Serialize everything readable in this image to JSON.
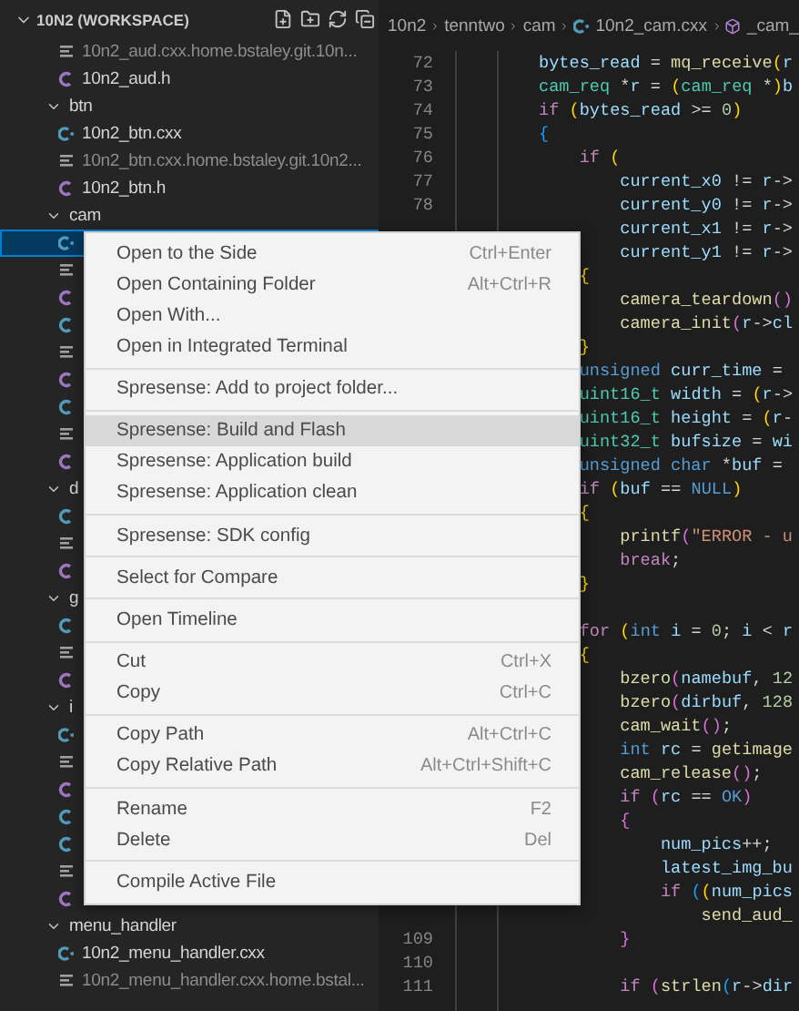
{
  "sidebar": {
    "title": "10N2 (WORKSPACE)",
    "expanded": true,
    "tree": [
      {
        "kind": "text",
        "name": "10n2_aud.cxx.home.bstaley.git.10n...",
        "dimmed": true,
        "selected": false
      },
      {
        "kind": "header",
        "name": "10n2_aud.h",
        "dimmed": false,
        "selected": false
      },
      {
        "kind": "folder",
        "name": "btn",
        "expanded": true,
        "selected": false,
        "children": [
          {
            "kind": "cpp",
            "name": "10n2_btn.cxx",
            "dimmed": false,
            "selected": false
          },
          {
            "kind": "text",
            "name": "10n2_btn.cxx.home.bstaley.git.10n2...",
            "dimmed": true,
            "selected": false
          },
          {
            "kind": "header",
            "name": "10n2_btn.h",
            "dimmed": false,
            "selected": false
          }
        ]
      },
      {
        "kind": "folder",
        "name": "cam",
        "expanded": true,
        "selected": false,
        "children": [
          {
            "kind": "cpp",
            "selected": true
          },
          {
            "kind": "text",
            "selected": false
          },
          {
            "kind": "header",
            "selected": false
          },
          {
            "kind": "c",
            "selected": false
          },
          {
            "kind": "text",
            "selected": false
          },
          {
            "kind": "header",
            "selected": false
          },
          {
            "kind": "c",
            "selected": false
          },
          {
            "kind": "text",
            "selected": false
          },
          {
            "kind": "header",
            "selected": false
          }
        ]
      },
      {
        "kind": "folder",
        "name": "d",
        "expanded": true,
        "selected": false,
        "children": [
          {
            "kind": "c",
            "selected": false
          },
          {
            "kind": "text",
            "selected": false
          },
          {
            "kind": "header",
            "selected": false
          }
        ]
      },
      {
        "kind": "folder",
        "name": "g",
        "expanded": true,
        "selected": false,
        "children": [
          {
            "kind": "c",
            "selected": false
          },
          {
            "kind": "text",
            "selected": false
          },
          {
            "kind": "header",
            "selected": false
          }
        ]
      },
      {
        "kind": "folder",
        "name": "i",
        "expanded": true,
        "selected": false,
        "children": [
          {
            "kind": "cpp",
            "selected": false
          },
          {
            "kind": "text",
            "selected": false
          },
          {
            "kind": "header",
            "selected": false
          },
          {
            "kind": "c",
            "selected": false
          },
          {
            "kind": "c",
            "selected": false
          },
          {
            "kind": "text",
            "selected": false
          },
          {
            "kind": "header",
            "selected": false
          }
        ]
      },
      {
        "kind": "folder",
        "name": "menu_handler",
        "expanded": true,
        "selected": false,
        "children": [
          {
            "kind": "cpp",
            "name": "10n2_menu_handler.cxx",
            "dimmed": false,
            "selected": false
          },
          {
            "kind": "text",
            "name": "10n2_menu_handler.cxx.home.bstal...",
            "dimmed": true,
            "selected": false
          }
        ]
      }
    ]
  },
  "breadcrumb": [
    {
      "kind": "folder",
      "label": "10n2"
    },
    {
      "kind": "folder",
      "label": "tenntwo"
    },
    {
      "kind": "folder",
      "label": "cam"
    },
    {
      "kind": "cpp",
      "label": "10n2_cam.cxx"
    },
    {
      "kind": "symbol",
      "label": "_cam_"
    }
  ],
  "editor": {
    "lines": [
      {
        "n": "72",
        "tokens": [
          {
            "kind": "var",
            "text": "bytes_read"
          },
          {
            "kind": "op",
            "text": " = "
          },
          {
            "kind": "fn",
            "text": "mq_receive"
          },
          {
            "kind": "b1",
            "text": "("
          },
          {
            "kind": "var",
            "text": "r"
          }
        ]
      },
      {
        "n": "73",
        "tokens": [
          {
            "kind": "type",
            "text": "cam_req"
          },
          {
            "kind": "op",
            "text": " *"
          },
          {
            "kind": "var",
            "text": "r"
          },
          {
            "kind": "op",
            "text": " = "
          },
          {
            "kind": "b1",
            "text": "("
          },
          {
            "kind": "type",
            "text": "cam_req"
          },
          {
            "kind": "op",
            "text": " *"
          },
          {
            "kind": "b1",
            "text": ")"
          },
          {
            "kind": "var",
            "text": "b"
          }
        ]
      },
      {
        "n": "74",
        "tokens": [
          {
            "kind": "kw",
            "text": "if "
          },
          {
            "kind": "b1",
            "text": "("
          },
          {
            "kind": "var",
            "text": "bytes_read"
          },
          {
            "kind": "op",
            "text": " >= "
          },
          {
            "kind": "num",
            "text": "0"
          },
          {
            "kind": "b1",
            "text": ")"
          }
        ]
      },
      {
        "n": "75",
        "tokens": [
          {
            "kind": "b3",
            "text": "{"
          }
        ]
      },
      {
        "n": "76",
        "tokens": [
          {
            "kind": "kw",
            "text": "    if "
          },
          {
            "kind": "b1",
            "text": "("
          }
        ]
      },
      {
        "n": "77",
        "tokens": [
          {
            "kind": "var",
            "text": "        current_x0"
          },
          {
            "kind": "op",
            "text": " != "
          },
          {
            "kind": "var",
            "text": "r"
          },
          {
            "kind": "op",
            "text": "->"
          }
        ]
      },
      {
        "n": "78",
        "tokens": [
          {
            "kind": "var",
            "text": "        current_y0"
          },
          {
            "kind": "op",
            "text": " != "
          },
          {
            "kind": "var",
            "text": "r"
          },
          {
            "kind": "op",
            "text": "->"
          }
        ]
      },
      {
        "tokens": [
          {
            "kind": "var",
            "text": "        current_x1"
          },
          {
            "kind": "op",
            "text": " != "
          },
          {
            "kind": "var",
            "text": "r"
          },
          {
            "kind": "op",
            "text": "->"
          }
        ]
      },
      {
        "tokens": [
          {
            "kind": "var",
            "text": "        current_y1"
          },
          {
            "kind": "op",
            "text": " != "
          },
          {
            "kind": "var",
            "text": "r"
          },
          {
            "kind": "op",
            "text": "->"
          }
        ]
      },
      {
        "tokens": [
          {
            "kind": "b1",
            "text": "    {"
          }
        ]
      },
      {
        "tokens": [
          {
            "kind": "fn",
            "text": "        camera_teardown"
          },
          {
            "kind": "b2",
            "text": "()"
          }
        ]
      },
      {
        "tokens": [
          {
            "kind": "fn",
            "text": "        camera_init"
          },
          {
            "kind": "b2",
            "text": "("
          },
          {
            "kind": "var",
            "text": "r"
          },
          {
            "kind": "op",
            "text": "->"
          },
          {
            "kind": "var",
            "text": "cl"
          }
        ]
      },
      {
        "tokens": [
          {
            "kind": "b1",
            "text": "    }"
          }
        ]
      },
      {
        "tokens": [
          {
            "kind": "kw2",
            "text": "    unsigned "
          },
          {
            "kind": "var",
            "text": "curr_time"
          },
          {
            "kind": "op",
            "text": " ="
          }
        ]
      },
      {
        "tokens": [
          {
            "kind": "type",
            "text": "    uint16_t "
          },
          {
            "kind": "var",
            "text": "width"
          },
          {
            "kind": "op",
            "text": " = "
          },
          {
            "kind": "b1",
            "text": "("
          },
          {
            "kind": "var",
            "text": "r"
          },
          {
            "kind": "op",
            "text": "->"
          }
        ]
      },
      {
        "tokens": [
          {
            "kind": "type",
            "text": "    uint16_t "
          },
          {
            "kind": "var",
            "text": "height"
          },
          {
            "kind": "op",
            "text": " = "
          },
          {
            "kind": "b1",
            "text": "("
          },
          {
            "kind": "var",
            "text": "r"
          },
          {
            "kind": "op",
            "text": "-"
          }
        ]
      },
      {
        "tokens": [
          {
            "kind": "type",
            "text": "    uint32_t "
          },
          {
            "kind": "var",
            "text": "bufsize"
          },
          {
            "kind": "op",
            "text": " = "
          },
          {
            "kind": "var",
            "text": "wi"
          }
        ]
      },
      {
        "tokens": [
          {
            "kind": "kw2",
            "text": "    unsigned char"
          },
          {
            "kind": "op",
            "text": " *"
          },
          {
            "kind": "var",
            "text": "buf"
          },
          {
            "kind": "op",
            "text": " ="
          }
        ]
      },
      {
        "tokens": [
          {
            "kind": "kw",
            "text": "    if "
          },
          {
            "kind": "b1",
            "text": "("
          },
          {
            "kind": "var",
            "text": "buf"
          },
          {
            "kind": "op",
            "text": " == "
          },
          {
            "kind": "kw2",
            "text": "NULL"
          },
          {
            "kind": "b1",
            "text": ")"
          }
        ]
      },
      {
        "tokens": [
          {
            "kind": "b1",
            "text": "    {"
          }
        ]
      },
      {
        "tokens": [
          {
            "kind": "fn",
            "text": "        printf"
          },
          {
            "kind": "b2",
            "text": "("
          },
          {
            "kind": "str",
            "text": "\"ERROR - u"
          }
        ]
      },
      {
        "tokens": [
          {
            "kind": "kw",
            "text": "        break"
          },
          {
            "kind": "op",
            "text": ";"
          }
        ]
      },
      {
        "tokens": [
          {
            "kind": "b1",
            "text": "    }"
          }
        ]
      },
      {
        "kind": "blank"
      },
      {
        "tokens": [
          {
            "kind": "kw",
            "text": "    for "
          },
          {
            "kind": "b1",
            "text": "("
          },
          {
            "kind": "kw2",
            "text": "int "
          },
          {
            "kind": "var",
            "text": "i"
          },
          {
            "kind": "op",
            "text": " = "
          },
          {
            "kind": "num",
            "text": "0"
          },
          {
            "kind": "op",
            "text": "; "
          },
          {
            "kind": "var",
            "text": "i"
          },
          {
            "kind": "op",
            "text": " < "
          },
          {
            "kind": "var",
            "text": "r"
          }
        ]
      },
      {
        "tokens": [
          {
            "kind": "b1",
            "text": "    {"
          }
        ]
      },
      {
        "tokens": [
          {
            "kind": "fn",
            "text": "        bzero"
          },
          {
            "kind": "b2",
            "text": "("
          },
          {
            "kind": "var",
            "text": "namebuf"
          },
          {
            "kind": "op",
            "text": ", "
          },
          {
            "kind": "num",
            "text": "12"
          }
        ]
      },
      {
        "tokens": [
          {
            "kind": "fn",
            "text": "        bzero"
          },
          {
            "kind": "b2",
            "text": "("
          },
          {
            "kind": "var",
            "text": "dirbuf"
          },
          {
            "kind": "op",
            "text": ", "
          },
          {
            "kind": "num",
            "text": "128"
          }
        ]
      },
      {
        "tokens": [
          {
            "kind": "fn",
            "text": "        cam_wait"
          },
          {
            "kind": "b2",
            "text": "()"
          },
          {
            "kind": "op",
            "text": ";"
          }
        ]
      },
      {
        "tokens": [
          {
            "kind": "kw2",
            "text": "        int "
          },
          {
            "kind": "var",
            "text": "rc"
          },
          {
            "kind": "op",
            "text": " = "
          },
          {
            "kind": "fn",
            "text": "getimage"
          }
        ]
      },
      {
        "tokens": [
          {
            "kind": "fn",
            "text": "        cam_release"
          },
          {
            "kind": "b2",
            "text": "()"
          },
          {
            "kind": "op",
            "text": ";"
          }
        ]
      },
      {
        "tokens": [
          {
            "kind": "kw",
            "text": "        if "
          },
          {
            "kind": "b2",
            "text": "("
          },
          {
            "kind": "var",
            "text": "rc"
          },
          {
            "kind": "op",
            "text": " == "
          },
          {
            "kind": "kw2",
            "text": "OK"
          },
          {
            "kind": "b2",
            "text": ")"
          }
        ]
      },
      {
        "tokens": [
          {
            "kind": "b2",
            "text": "        {"
          }
        ]
      },
      {
        "tokens": [
          {
            "kind": "var",
            "text": "            num_pics"
          },
          {
            "kind": "op",
            "text": "++;"
          }
        ]
      },
      {
        "tokens": [
          {
            "kind": "var",
            "text": "            latest_img_bu"
          }
        ]
      },
      {
        "tokens": [
          {
            "kind": "kw",
            "text": "            if "
          },
          {
            "kind": "b3",
            "text": "("
          },
          {
            "kind": "b1",
            "text": "("
          },
          {
            "kind": "var",
            "text": "num_pics"
          }
        ]
      },
      {
        "tokens": [
          {
            "kind": "fn",
            "text": "                send_aud_"
          }
        ]
      },
      {
        "n": "109",
        "tokens": [
          {
            "kind": "b2",
            "text": "        }"
          }
        ]
      },
      {
        "n": "110"
      },
      {
        "n": "111",
        "tokens": [
          {
            "kind": "kw",
            "text": "        if "
          },
          {
            "kind": "b2",
            "text": "("
          },
          {
            "kind": "fn",
            "text": "strlen"
          },
          {
            "kind": "b3",
            "text": "("
          },
          {
            "kind": "var",
            "text": "r"
          },
          {
            "kind": "op",
            "text": "->"
          },
          {
            "kind": "var",
            "text": "dir"
          }
        ]
      }
    ]
  },
  "context_menu": {
    "groups": [
      [
        {
          "label": "Open to the Side",
          "shortcut": "Ctrl+Enter",
          "highlighted": false
        },
        {
          "label": "Open Containing Folder",
          "shortcut": "Alt+Ctrl+R",
          "highlighted": false
        },
        {
          "label": "Open With...",
          "highlighted": false
        },
        {
          "label": "Open in Integrated Terminal",
          "highlighted": false
        }
      ],
      [
        {
          "label": "Spresense: Add to project folder...",
          "highlighted": false
        }
      ],
      [
        {
          "label": "Spresense: Build and Flash",
          "highlighted": true
        },
        {
          "label": "Spresense: Application build",
          "highlighted": false
        },
        {
          "label": "Spresense: Application clean",
          "highlighted": false
        }
      ],
      [
        {
          "label": "Spresense: SDK config",
          "highlighted": false
        }
      ],
      [
        {
          "label": "Select for Compare",
          "highlighted": false
        }
      ],
      [
        {
          "label": "Open Timeline",
          "highlighted": false
        }
      ],
      [
        {
          "label": "Cut",
          "shortcut": "Ctrl+X",
          "highlighted": false
        },
        {
          "label": "Copy",
          "shortcut": "Ctrl+C",
          "highlighted": false
        }
      ],
      [
        {
          "label": "Copy Path",
          "shortcut": "Alt+Ctrl+C",
          "highlighted": false
        },
        {
          "label": "Copy Relative Path",
          "shortcut": "Alt+Ctrl+Shift+C",
          "highlighted": false
        }
      ],
      [
        {
          "label": "Rename",
          "shortcut": "F2",
          "highlighted": false
        },
        {
          "label": "Delete",
          "shortcut": "Del",
          "highlighted": false
        }
      ],
      [
        {
          "label": "Compile Active File",
          "highlighted": false
        }
      ]
    ]
  }
}
